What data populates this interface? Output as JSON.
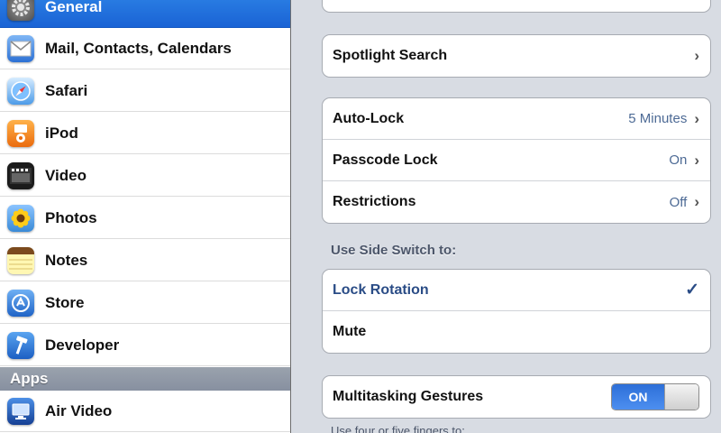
{
  "sidebar": {
    "items": [
      {
        "label": "General",
        "icon": "gear-icon",
        "selected": true
      },
      {
        "label": "Mail, Contacts, Calendars",
        "icon": "mail-icon"
      },
      {
        "label": "Safari",
        "icon": "compass-icon"
      },
      {
        "label": "iPod",
        "icon": "ipod-icon"
      },
      {
        "label": "Video",
        "icon": "film-icon"
      },
      {
        "label": "Photos",
        "icon": "sunflower-icon"
      },
      {
        "label": "Notes",
        "icon": "notepad-icon"
      },
      {
        "label": "Store",
        "icon": "store-icon"
      },
      {
        "label": "Developer",
        "icon": "hammer-icon"
      }
    ],
    "section_header": "Apps",
    "apps": [
      {
        "label": "Air Video",
        "icon": "monitor-icon"
      }
    ]
  },
  "settings": {
    "spotlight": {
      "label": "Spotlight Search"
    },
    "lock_group": [
      {
        "label": "Auto-Lock",
        "value": "5 Minutes"
      },
      {
        "label": "Passcode Lock",
        "value": "On"
      },
      {
        "label": "Restrictions",
        "value": "Off"
      }
    ],
    "side_switch_title": "Use Side Switch to:",
    "side_switch_options": [
      {
        "label": "Lock Rotation",
        "checked": true
      },
      {
        "label": "Mute",
        "checked": false
      }
    ],
    "multitasking": {
      "label": "Multitasking Gestures",
      "toggle_text": "ON"
    },
    "footer": "Use four or five fingers to:"
  },
  "colors": {
    "selected_row": "#1f6ddc",
    "value_text": "#4d6a95",
    "checked_text": "#2a4c86"
  }
}
